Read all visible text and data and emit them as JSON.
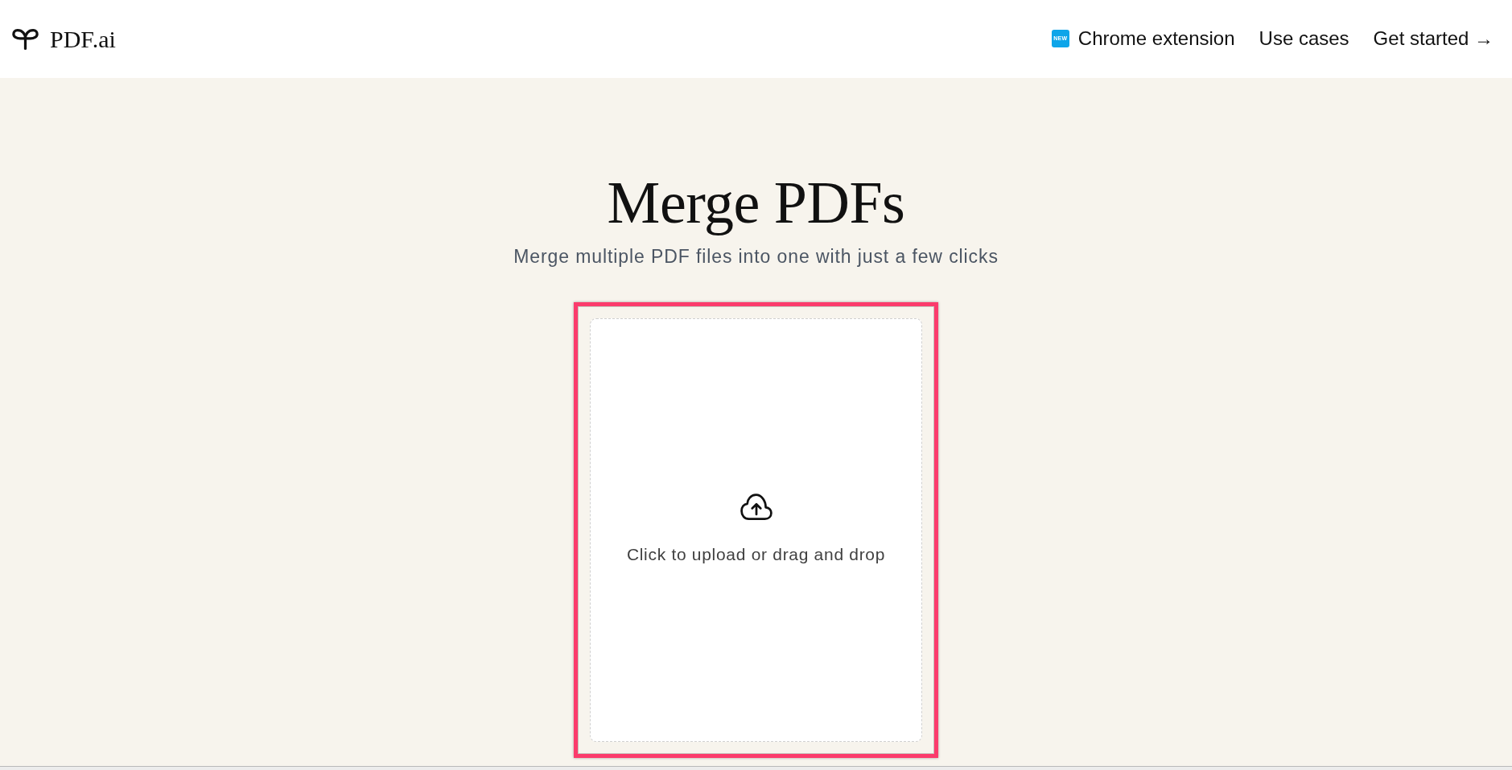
{
  "header": {
    "logo": "PDF.ai",
    "nav": [
      {
        "kind": "badge-link",
        "badge": "NEW",
        "label": "Chrome extension"
      },
      {
        "kind": "link",
        "label": "Use cases"
      },
      {
        "kind": "link",
        "label": "Get started →"
      }
    ]
  },
  "hero": {
    "title": "Merge PDFs",
    "subtitle": "Merge multiple PDF files into one with just a few clicks"
  },
  "upload": {
    "highlighted": true,
    "prompt": "Click to upload or drag and drop"
  }
}
